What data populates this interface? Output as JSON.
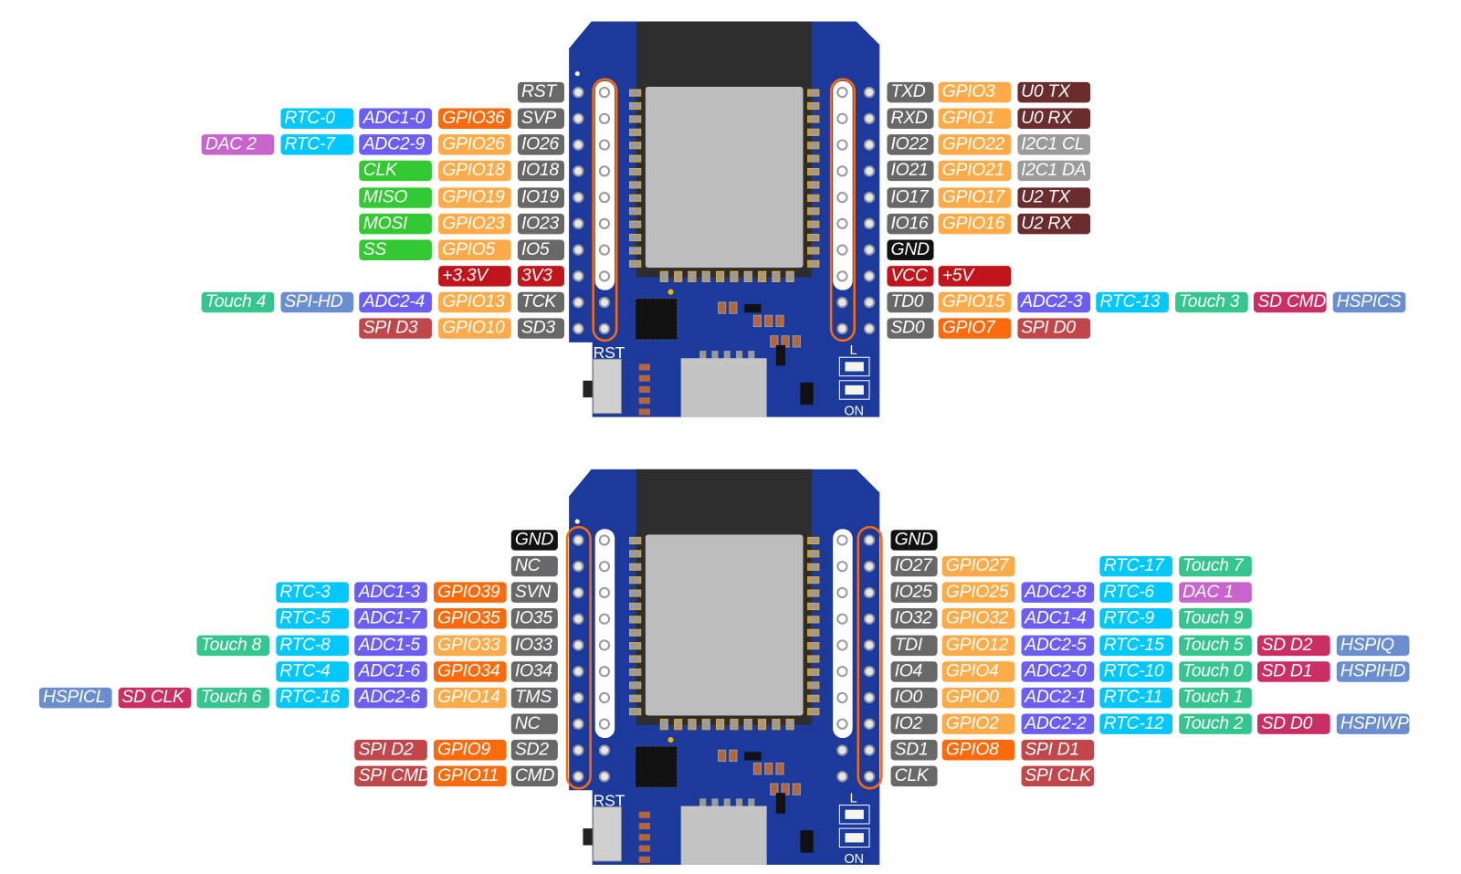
{
  "colors": {
    "name": "#686868",
    "gnd": "#111111",
    "power": "#c1151b",
    "gpio": "#fdab48",
    "gpio_dark": "#fb6a0c",
    "adc": "#6c5ef2",
    "rtc": "#00c8fd",
    "touch": "#34c68e",
    "dac": "#c864cc",
    "spi": "#33c933",
    "hspi": "#6b8ed0",
    "flash": "#c2474a",
    "sd": "#cb2e62",
    "uart": "#6a2c2c",
    "i2c": "#9b9b9b",
    "pcb": "#1c3a9c",
    "highlight": "#ff6a00"
  },
  "boards": [
    {
      "view": "top",
      "highlight": "inner",
      "silkscreen": {
        "rst": "RST",
        "led": "L",
        "on": "ON"
      },
      "left_pins": [
        [
          {
            "t": "RST",
            "c": "name"
          }
        ],
        [
          {
            "t": "SVP",
            "c": "name"
          },
          {
            "t": "GPIO36",
            "c": "gpio_dark"
          },
          {
            "t": "ADC1-0",
            "c": "adc"
          },
          {
            "t": "RTC-0",
            "c": "rtc"
          }
        ],
        [
          {
            "t": "IO26",
            "c": "name"
          },
          {
            "t": "GPIO26",
            "c": "gpio"
          },
          {
            "t": "ADC2-9",
            "c": "adc"
          },
          {
            "t": "RTC-7",
            "c": "rtc"
          },
          {
            "t": "DAC 2",
            "c": "dac"
          }
        ],
        [
          {
            "t": "IO18",
            "c": "name"
          },
          {
            "t": "GPIO18",
            "c": "gpio"
          },
          {
            "t": "CLK",
            "c": "spi"
          }
        ],
        [
          {
            "t": "IO19",
            "c": "name"
          },
          {
            "t": "GPIO19",
            "c": "gpio"
          },
          {
            "t": "MISO",
            "c": "spi"
          }
        ],
        [
          {
            "t": "IO23",
            "c": "name"
          },
          {
            "t": "GPIO23",
            "c": "gpio"
          },
          {
            "t": "MOSI",
            "c": "spi"
          }
        ],
        [
          {
            "t": "IO5",
            "c": "name"
          },
          {
            "t": "GPIO5",
            "c": "gpio"
          },
          {
            "t": "SS",
            "c": "spi"
          }
        ],
        [
          {
            "t": "3V3",
            "c": "power"
          },
          {
            "t": "+3.3V",
            "c": "power"
          }
        ],
        [
          {
            "t": "TCK",
            "c": "name"
          },
          {
            "t": "GPIO13",
            "c": "gpio"
          },
          {
            "t": "ADC2-4",
            "c": "adc"
          },
          {
            "t": "SPI-HD",
            "c": "hspi"
          },
          {
            "t": "Touch 4",
            "c": "touch"
          }
        ],
        [
          {
            "t": "SD3",
            "c": "name"
          },
          {
            "t": "GPIO10",
            "c": "gpio"
          },
          {
            "t": "SPI D3",
            "c": "flash"
          }
        ]
      ],
      "right_pins": [
        [
          {
            "t": "TXD",
            "c": "name"
          },
          {
            "t": "GPIO3",
            "c": "gpio"
          },
          {
            "t": "U0 TX",
            "c": "uart"
          }
        ],
        [
          {
            "t": "RXD",
            "c": "name"
          },
          {
            "t": "GPIO1",
            "c": "gpio"
          },
          {
            "t": "U0 RX",
            "c": "uart"
          }
        ],
        [
          {
            "t": "IO22",
            "c": "name"
          },
          {
            "t": "GPIO22",
            "c": "gpio"
          },
          {
            "t": "I2C1 CL",
            "c": "i2c"
          }
        ],
        [
          {
            "t": "IO21",
            "c": "name"
          },
          {
            "t": "GPIO21",
            "c": "gpio"
          },
          {
            "t": "I2C1 DA",
            "c": "i2c"
          }
        ],
        [
          {
            "t": "IO17",
            "c": "name"
          },
          {
            "t": "GPIO17",
            "c": "gpio"
          },
          {
            "t": "U2 TX",
            "c": "uart"
          }
        ],
        [
          {
            "t": "IO16",
            "c": "name"
          },
          {
            "t": "GPIO16",
            "c": "gpio"
          },
          {
            "t": "U2 RX",
            "c": "uart"
          }
        ],
        [
          {
            "t": "GND",
            "c": "gnd"
          }
        ],
        [
          {
            "t": "VCC",
            "c": "power"
          },
          {
            "t": "+5V",
            "c": "power"
          }
        ],
        [
          {
            "t": "TD0",
            "c": "name"
          },
          {
            "t": "GPIO15",
            "c": "gpio"
          },
          {
            "t": "ADC2-3",
            "c": "adc"
          },
          {
            "t": "RTC-13",
            "c": "rtc"
          },
          {
            "t": "Touch 3",
            "c": "touch"
          },
          {
            "t": "SD CMD",
            "c": "sd"
          },
          {
            "t": "HSPICS",
            "c": "hspi"
          }
        ],
        [
          {
            "t": "SD0",
            "c": "name"
          },
          {
            "t": "GPIO7",
            "c": "gpio_dark"
          },
          {
            "t": "SPI D0",
            "c": "flash"
          }
        ]
      ]
    },
    {
      "view": "bottom",
      "highlight": "outer",
      "silkscreen": {
        "rst": "RST",
        "led": "L",
        "on": "ON"
      },
      "left_pins": [
        [
          {
            "t": "GND",
            "c": "gnd"
          }
        ],
        [
          {
            "t": "NC",
            "c": "name"
          }
        ],
        [
          {
            "t": "SVN",
            "c": "name"
          },
          {
            "t": "GPIO39",
            "c": "gpio_dark"
          },
          {
            "t": "ADC1-3",
            "c": "adc"
          },
          {
            "t": "RTC-3",
            "c": "rtc"
          }
        ],
        [
          {
            "t": "IO35",
            "c": "name"
          },
          {
            "t": "GPIO35",
            "c": "gpio_dark"
          },
          {
            "t": "ADC1-7",
            "c": "adc"
          },
          {
            "t": "RTC-5",
            "c": "rtc"
          }
        ],
        [
          {
            "t": "IO33",
            "c": "name"
          },
          {
            "t": "GPIO33",
            "c": "gpio"
          },
          {
            "t": "ADC1-5",
            "c": "adc"
          },
          {
            "t": "RTC-8",
            "c": "rtc"
          },
          {
            "t": "Touch 8",
            "c": "touch"
          }
        ],
        [
          {
            "t": "IO34",
            "c": "name"
          },
          {
            "t": "GPIO34",
            "c": "gpio_dark"
          },
          {
            "t": "ADC1-6",
            "c": "adc"
          },
          {
            "t": "RTC-4",
            "c": "rtc"
          }
        ],
        [
          {
            "t": "TMS",
            "c": "name"
          },
          {
            "t": "GPIO14",
            "c": "gpio"
          },
          {
            "t": "ADC2-6",
            "c": "adc"
          },
          {
            "t": "RTC-16",
            "c": "rtc"
          },
          {
            "t": "Touch 6",
            "c": "touch"
          },
          {
            "t": "SD CLK",
            "c": "sd"
          },
          {
            "t": "HSPICL",
            "c": "hspi"
          }
        ],
        [
          {
            "t": "NC",
            "c": "name"
          }
        ],
        [
          {
            "t": "SD2",
            "c": "name"
          },
          {
            "t": "GPIO9",
            "c": "gpio_dark"
          },
          {
            "t": "SPI D2",
            "c": "flash"
          }
        ],
        [
          {
            "t": "CMD",
            "c": "name"
          },
          {
            "t": "GPIO11",
            "c": "gpio_dark"
          },
          {
            "t": "SPI CMD",
            "c": "flash"
          }
        ]
      ],
      "right_pins": [
        [
          {
            "t": "GND",
            "c": "gnd"
          }
        ],
        [
          {
            "t": "IO27",
            "c": "name"
          },
          {
            "t": "GPIO27",
            "c": "gpio"
          },
          null,
          {
            "t": "RTC-17",
            "c": "rtc"
          },
          {
            "t": "Touch 7",
            "c": "touch"
          }
        ],
        [
          {
            "t": "IO25",
            "c": "name"
          },
          {
            "t": "GPIO25",
            "c": "gpio"
          },
          {
            "t": "ADC2-8",
            "c": "adc"
          },
          {
            "t": "RTC-6",
            "c": "rtc"
          },
          {
            "t": "DAC 1",
            "c": "dac"
          }
        ],
        [
          {
            "t": "IO32",
            "c": "name"
          },
          {
            "t": "GPIO32",
            "c": "gpio"
          },
          {
            "t": "ADC1-4",
            "c": "adc"
          },
          {
            "t": "RTC-9",
            "c": "rtc"
          },
          {
            "t": "Touch 9",
            "c": "touch"
          }
        ],
        [
          {
            "t": "TDI",
            "c": "name"
          },
          {
            "t": "GPIO12",
            "c": "gpio"
          },
          {
            "t": "ADC2-5",
            "c": "adc"
          },
          {
            "t": "RTC-15",
            "c": "rtc"
          },
          {
            "t": "Touch 5",
            "c": "touch"
          },
          {
            "t": "SD D2",
            "c": "sd"
          },
          {
            "t": "HSPIQ",
            "c": "hspi"
          }
        ],
        [
          {
            "t": "IO4",
            "c": "name"
          },
          {
            "t": "GPIO4",
            "c": "gpio"
          },
          {
            "t": "ADC2-0",
            "c": "adc"
          },
          {
            "t": "RTC-10",
            "c": "rtc"
          },
          {
            "t": "Touch 0",
            "c": "touch"
          },
          {
            "t": "SD D1",
            "c": "sd"
          },
          {
            "t": "HSPIHD",
            "c": "hspi"
          }
        ],
        [
          {
            "t": "IO0",
            "c": "name"
          },
          {
            "t": "GPIO0",
            "c": "gpio"
          },
          {
            "t": "ADC2-1",
            "c": "adc"
          },
          {
            "t": "RTC-11",
            "c": "rtc"
          },
          {
            "t": "Touch 1",
            "c": "touch"
          }
        ],
        [
          {
            "t": "IO2",
            "c": "name"
          },
          {
            "t": "GPIO2",
            "c": "gpio"
          },
          {
            "t": "ADC2-2",
            "c": "adc"
          },
          {
            "t": "RTC-12",
            "c": "rtc"
          },
          {
            "t": "Touch 2",
            "c": "touch"
          },
          {
            "t": "SD D0",
            "c": "sd"
          },
          {
            "t": "HSPIWP",
            "c": "hspi"
          }
        ],
        [
          {
            "t": "SD1",
            "c": "name"
          },
          {
            "t": "GPIO8",
            "c": "gpio_dark"
          },
          {
            "t": "SPI D1",
            "c": "flash"
          }
        ],
        [
          {
            "t": "CLK",
            "c": "name"
          },
          null,
          {
            "t": "SPI CLK",
            "c": "flash"
          }
        ]
      ]
    }
  ]
}
